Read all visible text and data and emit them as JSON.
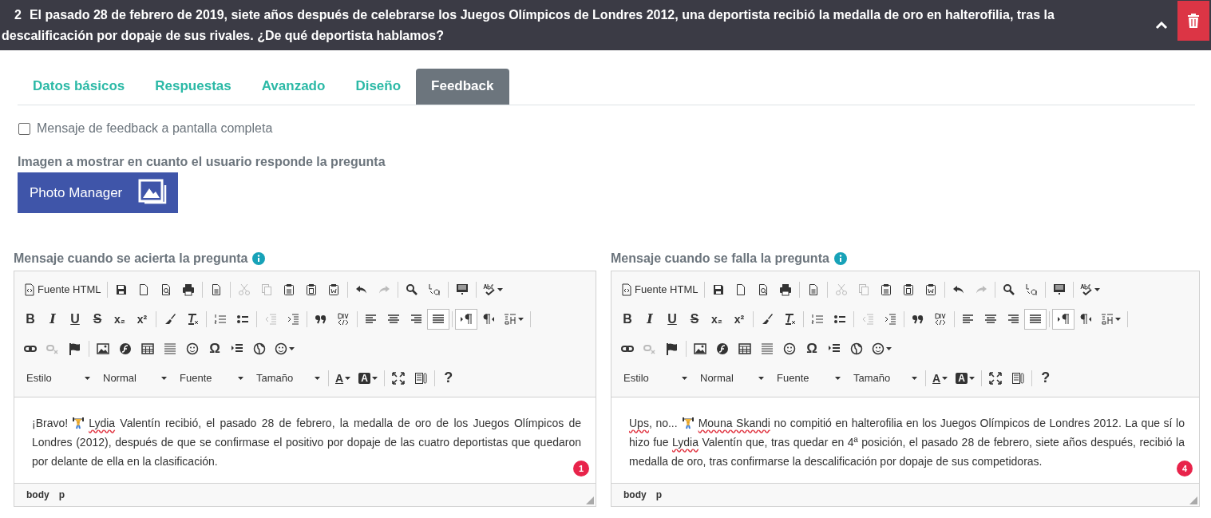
{
  "question": {
    "number": "2",
    "text": "El pasado 28 de febrero de 2019, siete años después de celebrarse los Juegos Olímpicos de Londres 2012, una deportista recibió la medalla de oro en halterofilia, tras la descalificación por dopaje de sus rivales. ¿De qué deportista hablamos?"
  },
  "tabs": [
    {
      "label": "Datos básicos",
      "selected": false
    },
    {
      "label": "Respuestas",
      "selected": false
    },
    {
      "label": "Avanzado",
      "selected": false
    },
    {
      "label": "Diseño",
      "selected": false
    },
    {
      "label": "Feedback",
      "selected": true
    }
  ],
  "fullscreen_option": {
    "label": "Mensaje de feedback a pantalla completa",
    "checked": false
  },
  "image_section": {
    "label": "Imagen a mostrar en cuanto el usuario responde la pregunta",
    "button": "Photo Manager"
  },
  "editors": [
    {
      "label": "Mensaje cuando se acierta la pregunta",
      "count": "1",
      "path": [
        "body",
        "p"
      ],
      "content": [
        {
          "kind": "text",
          "parts": [
            {
              "text": "¡Bravo!",
              "misspelled": false
            }
          ]
        },
        {
          "kind": "emoji"
        },
        {
          "kind": "text",
          "parts": [
            {
              "text": "Lydia",
              "misspelled": true
            },
            {
              "text": " Valentín recibió, el pasado 28 de febrero, la medalla de oro de los Juegos Olímpicos de Londres (2012), después de que se confirmase el positivo por dopaje de las cuatro deportistas que quedaron por delante de ella en la clasificación.",
              "misspelled": false
            }
          ]
        }
      ],
      "toolbar": [
        [
          [
            {
              "kind": "source",
              "label": "Fuente HTML",
              "disabled": false,
              "pressed": false
            }
          ],
          [
            {
              "kind": "save",
              "disabled": false,
              "pressed": false
            },
            {
              "kind": "new-page",
              "disabled": false,
              "pressed": false
            },
            {
              "kind": "preview",
              "disabled": false,
              "pressed": false
            },
            {
              "kind": "print",
              "disabled": false,
              "pressed": false
            }
          ],
          [
            {
              "kind": "templates",
              "disabled": false,
              "pressed": false
            }
          ],
          [
            {
              "kind": "cut",
              "disabled": true,
              "pressed": false
            },
            {
              "kind": "copy",
              "disabled": true,
              "pressed": false
            },
            {
              "kind": "paste",
              "disabled": false,
              "pressed": false
            },
            {
              "kind": "paste-text",
              "disabled": false,
              "pressed": false
            },
            {
              "kind": "paste-word",
              "disabled": false,
              "pressed": false
            }
          ],
          [
            {
              "kind": "undo",
              "disabled": false,
              "pressed": false
            },
            {
              "kind": "redo",
              "disabled": true,
              "pressed": false
            }
          ],
          [
            {
              "kind": "find",
              "disabled": false,
              "pressed": false
            },
            {
              "kind": "replace",
              "disabled": false,
              "pressed": false
            }
          ],
          [
            {
              "kind": "select-all",
              "disabled": false,
              "pressed": false
            }
          ],
          [
            {
              "kind": "spellcheck",
              "disabled": false,
              "pressed": false
            }
          ]
        ],
        [
          [
            {
              "kind": "bold",
              "glyph": "B",
              "disabled": false,
              "pressed": false
            },
            {
              "kind": "italic",
              "glyph": "I",
              "disabled": false,
              "pressed": false
            },
            {
              "kind": "underline",
              "glyph": "U",
              "disabled": false,
              "pressed": false
            },
            {
              "kind": "strike",
              "glyph": "S",
              "disabled": false,
              "pressed": false
            },
            {
              "kind": "subscript",
              "glyph": "x₂",
              "disabled": false,
              "pressed": false
            },
            {
              "kind": "superscript",
              "glyph": "x²",
              "disabled": false,
              "pressed": false
            }
          ],
          [
            {
              "kind": "brush",
              "disabled": false,
              "pressed": false
            },
            {
              "kind": "remove-format",
              "disabled": false,
              "pressed": false
            }
          ],
          [
            {
              "kind": "numbered-list",
              "disabled": false,
              "pressed": false
            },
            {
              "kind": "bulleted-list",
              "disabled": false,
              "pressed": false
            }
          ],
          [
            {
              "kind": "outdent",
              "disabled": true,
              "pressed": false
            },
            {
              "kind": "indent",
              "disabled": false,
              "pressed": false
            }
          ],
          [
            {
              "kind": "blockquote",
              "disabled": false,
              "pressed": false
            },
            {
              "kind": "div",
              "disabled": false,
              "pressed": false
            }
          ],
          [
            {
              "kind": "align-left",
              "disabled": false,
              "pressed": false
            },
            {
              "kind": "align-center",
              "disabled": false,
              "pressed": false
            },
            {
              "kind": "align-right",
              "disabled": false,
              "pressed": false
            },
            {
              "kind": "justify",
              "disabled": false,
              "pressed": true
            }
          ],
          [
            {
              "kind": "ltr",
              "disabled": false,
              "pressed": true
            },
            {
              "kind": "rtl",
              "disabled": false,
              "pressed": false
            },
            {
              "kind": "language",
              "disabled": false,
              "pressed": false
            }
          ]
        ],
        [
          [
            {
              "kind": "link",
              "disabled": false,
              "pressed": false
            },
            {
              "kind": "unlink",
              "disabled": true,
              "pressed": false
            },
            {
              "kind": "flag",
              "disabled": false,
              "pressed": false
            }
          ],
          [
            {
              "kind": "image",
              "disabled": false,
              "pressed": false
            },
            {
              "kind": "flash",
              "disabled": false,
              "pressed": false
            },
            {
              "kind": "table",
              "disabled": false,
              "pressed": false
            },
            {
              "kind": "horizontal-rule",
              "disabled": false,
              "pressed": false
            },
            {
              "kind": "smiley",
              "disabled": false,
              "pressed": false
            },
            {
              "kind": "special-char",
              "glyph": "Ω",
              "disabled": false,
              "pressed": false
            },
            {
              "kind": "page-break",
              "disabled": false,
              "pressed": false
            },
            {
              "kind": "globe",
              "disabled": false,
              "pressed": false
            },
            {
              "kind": "emoji",
              "disabled": false,
              "pressed": false
            }
          ]
        ],
        [
          [
            {
              "kind": "combo",
              "label": "Estilo",
              "disabled": false,
              "pressed": false
            },
            {
              "kind": "combo",
              "label": "Normal",
              "disabled": false,
              "pressed": false
            },
            {
              "kind": "combo",
              "label": "Fuente",
              "disabled": false,
              "pressed": false
            },
            {
              "kind": "combo",
              "label": "Tamaño",
              "disabled": false,
              "pressed": false
            }
          ],
          [
            {
              "kind": "text-color",
              "glyph": "A",
              "disabled": false,
              "pressed": false
            },
            {
              "kind": "background-color",
              "glyph": "A",
              "disabled": false,
              "pressed": false
            }
          ],
          [
            {
              "kind": "maximize",
              "disabled": false,
              "pressed": false
            },
            {
              "kind": "show-blocks",
              "disabled": false,
              "pressed": false
            }
          ],
          [
            {
              "kind": "help",
              "glyph": "?",
              "disabled": false,
              "pressed": false
            }
          ]
        ]
      ]
    },
    {
      "label": "Mensaje cuando se falla la pregunta",
      "count": "4",
      "path": [
        "body",
        "p"
      ],
      "content": [
        {
          "kind": "text",
          "parts": [
            {
              "text": "Ups",
              "misspelled": true
            },
            {
              "text": ", no...",
              "misspelled": false
            }
          ]
        },
        {
          "kind": "emoji"
        },
        {
          "kind": "text",
          "parts": [
            {
              "text": "Mouna Skandi",
              "misspelled": true
            },
            {
              "text": " no compitió en halterofilia en los Juegos Olímpicos de Londres 2012. La que sí lo hizo fue ",
              "misspelled": false
            },
            {
              "text": "Lydia",
              "misspelled": true
            },
            {
              "text": " Valentín que, tras quedar en 4ª posición, el pasado 28 de febrero, siete años después, recibió la medalla de oro, tras confirmarse la descalificación por dopaje de sus competidoras.",
              "misspelled": false
            }
          ]
        }
      ],
      "toolbar": [
        [
          [
            {
              "kind": "source",
              "label": "Fuente HTML",
              "disabled": false,
              "pressed": false
            }
          ],
          [
            {
              "kind": "save",
              "disabled": false,
              "pressed": false
            },
            {
              "kind": "new-page",
              "disabled": false,
              "pressed": false
            },
            {
              "kind": "preview",
              "disabled": false,
              "pressed": false
            },
            {
              "kind": "print",
              "disabled": false,
              "pressed": false
            }
          ],
          [
            {
              "kind": "templates",
              "disabled": false,
              "pressed": false
            }
          ],
          [
            {
              "kind": "cut",
              "disabled": true,
              "pressed": false
            },
            {
              "kind": "copy",
              "disabled": true,
              "pressed": false
            },
            {
              "kind": "paste",
              "disabled": false,
              "pressed": false
            },
            {
              "kind": "paste-text",
              "disabled": false,
              "pressed": false
            },
            {
              "kind": "paste-word",
              "disabled": false,
              "pressed": false
            }
          ],
          [
            {
              "kind": "undo",
              "disabled": false,
              "pressed": false
            },
            {
              "kind": "redo",
              "disabled": true,
              "pressed": false
            }
          ],
          [
            {
              "kind": "find",
              "disabled": false,
              "pressed": false
            },
            {
              "kind": "replace",
              "disabled": false,
              "pressed": false
            }
          ],
          [
            {
              "kind": "select-all",
              "disabled": false,
              "pressed": false
            }
          ],
          [
            {
              "kind": "spellcheck",
              "disabled": false,
              "pressed": false
            }
          ]
        ],
        [
          [
            {
              "kind": "bold",
              "glyph": "B",
              "disabled": false,
              "pressed": false
            },
            {
              "kind": "italic",
              "glyph": "I",
              "disabled": false,
              "pressed": false
            },
            {
              "kind": "underline",
              "glyph": "U",
              "disabled": false,
              "pressed": false
            },
            {
              "kind": "strike",
              "glyph": "S",
              "disabled": false,
              "pressed": false
            },
            {
              "kind": "subscript",
              "glyph": "x₂",
              "disabled": false,
              "pressed": false
            },
            {
              "kind": "superscript",
              "glyph": "x²",
              "disabled": false,
              "pressed": false
            }
          ],
          [
            {
              "kind": "brush",
              "disabled": false,
              "pressed": false
            },
            {
              "kind": "remove-format",
              "disabled": false,
              "pressed": false
            }
          ],
          [
            {
              "kind": "numbered-list",
              "disabled": false,
              "pressed": false
            },
            {
              "kind": "bulleted-list",
              "disabled": false,
              "pressed": false
            }
          ],
          [
            {
              "kind": "outdent",
              "disabled": true,
              "pressed": false
            },
            {
              "kind": "indent",
              "disabled": false,
              "pressed": false
            }
          ],
          [
            {
              "kind": "blockquote",
              "disabled": false,
              "pressed": false
            },
            {
              "kind": "div",
              "disabled": false,
              "pressed": false
            }
          ],
          [
            {
              "kind": "align-left",
              "disabled": false,
              "pressed": false
            },
            {
              "kind": "align-center",
              "disabled": false,
              "pressed": false
            },
            {
              "kind": "align-right",
              "disabled": false,
              "pressed": false
            },
            {
              "kind": "justify",
              "disabled": false,
              "pressed": true
            }
          ],
          [
            {
              "kind": "ltr",
              "disabled": false,
              "pressed": true
            },
            {
              "kind": "rtl",
              "disabled": false,
              "pressed": false
            },
            {
              "kind": "language",
              "disabled": false,
              "pressed": false
            }
          ]
        ],
        [
          [
            {
              "kind": "link",
              "disabled": false,
              "pressed": false
            },
            {
              "kind": "unlink",
              "disabled": true,
              "pressed": false
            },
            {
              "kind": "flag",
              "disabled": false,
              "pressed": false
            }
          ],
          [
            {
              "kind": "image",
              "disabled": false,
              "pressed": false
            },
            {
              "kind": "flash",
              "disabled": false,
              "pressed": false
            },
            {
              "kind": "table",
              "disabled": false,
              "pressed": false
            },
            {
              "kind": "horizontal-rule",
              "disabled": false,
              "pressed": false
            },
            {
              "kind": "smiley",
              "disabled": false,
              "pressed": false
            },
            {
              "kind": "special-char",
              "glyph": "Ω",
              "disabled": false,
              "pressed": false
            },
            {
              "kind": "page-break",
              "disabled": false,
              "pressed": false
            },
            {
              "kind": "globe",
              "disabled": false,
              "pressed": false
            },
            {
              "kind": "emoji",
              "disabled": false,
              "pressed": false
            }
          ]
        ],
        [
          [
            {
              "kind": "combo",
              "label": "Estilo",
              "disabled": false,
              "pressed": false
            },
            {
              "kind": "combo",
              "label": "Normal",
              "disabled": false,
              "pressed": false
            },
            {
              "kind": "combo",
              "label": "Fuente",
              "disabled": false,
              "pressed": false
            },
            {
              "kind": "combo",
              "label": "Tamaño",
              "disabled": false,
              "pressed": false
            }
          ],
          [
            {
              "kind": "text-color",
              "glyph": "A",
              "disabled": false,
              "pressed": false
            },
            {
              "kind": "background-color",
              "glyph": "A",
              "disabled": false,
              "pressed": false
            }
          ],
          [
            {
              "kind": "maximize",
              "disabled": false,
              "pressed": false
            },
            {
              "kind": "show-blocks",
              "disabled": false,
              "pressed": false
            }
          ],
          [
            {
              "kind": "help",
              "glyph": "?",
              "disabled": false,
              "pressed": false
            }
          ]
        ]
      ]
    }
  ]
}
